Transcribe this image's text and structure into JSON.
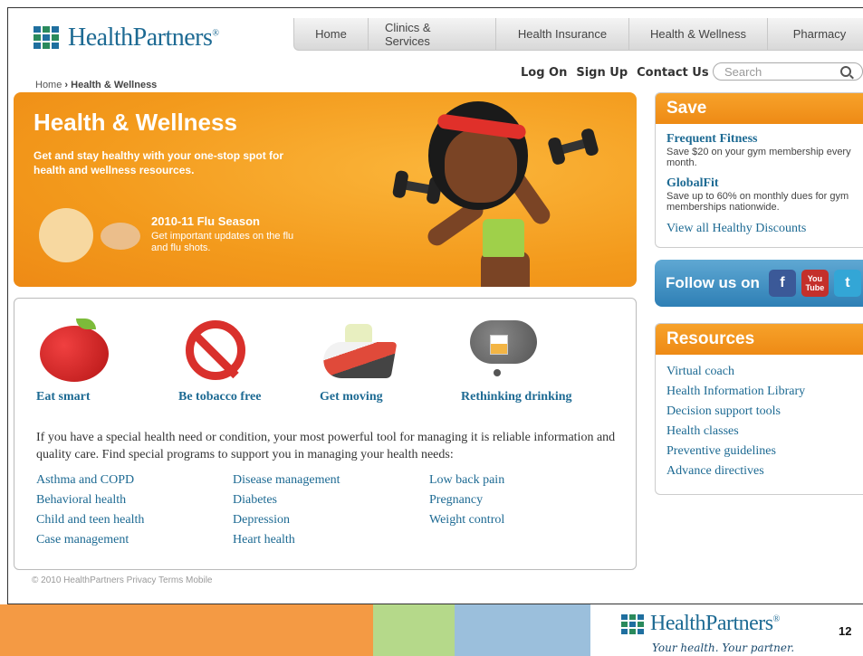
{
  "brand": {
    "name": "HealthPartners",
    "tagline": "Your health. Your partner."
  },
  "nav": {
    "tabs": [
      "Home",
      "Clinics & Services",
      "Health Insurance",
      "Health & Wellness",
      "Pharmacy"
    ]
  },
  "utility": {
    "login": "Log On",
    "signup": "Sign Up",
    "contact": "Contact Us",
    "search_placeholder": "Search"
  },
  "breadcrumb": {
    "home": "Home",
    "sep": "›",
    "current": "Health & Wellness"
  },
  "hero": {
    "title": "Health & Wellness",
    "subtitle": "Get and stay healthy with your one-stop spot for health and wellness resources.",
    "flu_title": "2010-11 Flu Season",
    "flu_desc": "Get important updates on the flu and flu shots."
  },
  "tiles": [
    "Eat smart",
    "Be tobacco free",
    "Get moving",
    "Rethinking drinking"
  ],
  "intro": "If you have a special health need or condition, your most powerful tool for managing it is reliable information and quality care. Find special programs to support you in managing your health needs:",
  "programs": {
    "col1": [
      "Asthma and COPD",
      "Behavioral health",
      "Child and teen health",
      "Case management"
    ],
    "col2": [
      "Disease management",
      "Diabetes",
      "Depression",
      "Heart health"
    ],
    "col3": [
      "Low back pain",
      "Pregnancy",
      "Weight control"
    ]
  },
  "footer": {
    "text": "© 2010 HealthPartners    Privacy    Terms    Mobile"
  },
  "save": {
    "title": "Save",
    "items": [
      {
        "title": "Frequent Fitness",
        "desc": "Save $20 on your gym membership every month."
      },
      {
        "title": "GlobalFit",
        "desc": "Save up to 60% on monthly dues for gym memberships nationwide."
      }
    ],
    "view_all": "View all Healthy Discounts"
  },
  "follow": {
    "label": "Follow us on",
    "youtube_line1": "You",
    "youtube_line2": "Tube"
  },
  "resources": {
    "title": "Resources",
    "items": [
      "Virtual coach",
      "Health Information Library",
      "Decision support tools",
      "Health classes",
      "Preventive guidelines",
      "Advance directives"
    ]
  },
  "slide": {
    "page_number": "12"
  },
  "colors": {
    "brand_blue": "#1d6a93",
    "orange": "#f39a1c",
    "green": "#2a8a5c"
  }
}
